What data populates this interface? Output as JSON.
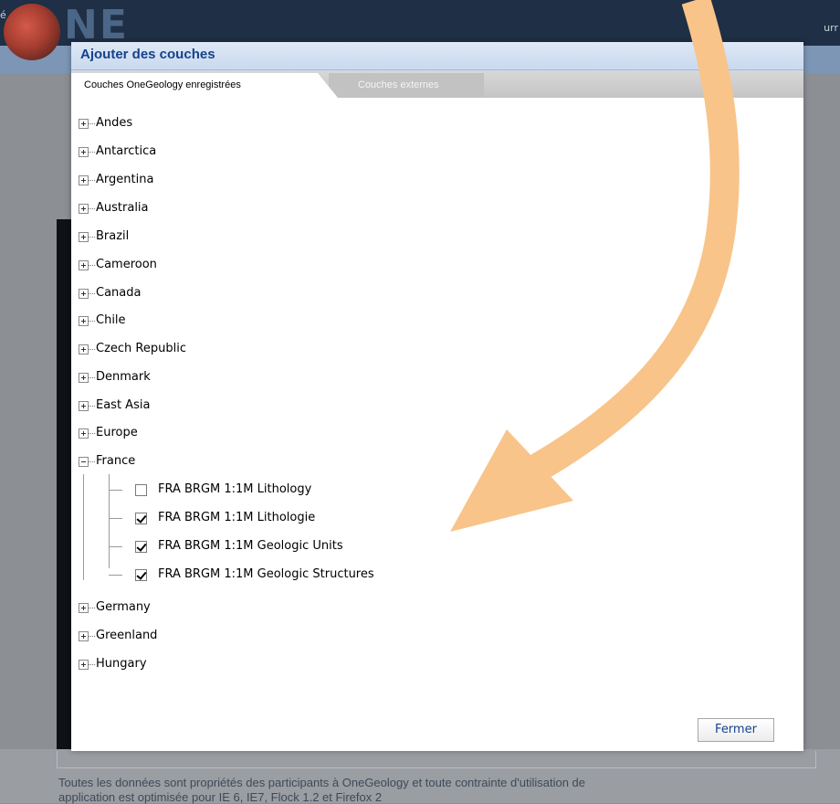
{
  "background": {
    "logo_text": "NE",
    "edge_left_text": "é",
    "edge_right_text": "urr",
    "footer_text_line1": "Toutes les données sont propriétés des participants à OneGeology et toute contrainte d'utilisation de",
    "footer_text_line2": "application est optimisée pour IE 6, IE7, Flock 1.2 et Firefox 2"
  },
  "dialog": {
    "title": "Ajouter des couches",
    "tabs": [
      {
        "label": "Couches OneGeology enregistrées",
        "active": true
      },
      {
        "label": "Couches externes",
        "active": false
      }
    ],
    "tree_top": [
      {
        "label": "Andes"
      },
      {
        "label": "Antarctica"
      },
      {
        "label": "Argentina"
      },
      {
        "label": "Australia"
      },
      {
        "label": "Brazil"
      },
      {
        "label": "Cameroon"
      },
      {
        "label": "Canada"
      },
      {
        "label": "Chile"
      },
      {
        "label": "Czech Republic"
      },
      {
        "label": "Denmark"
      },
      {
        "label": "East Asia"
      },
      {
        "label": "Europe"
      }
    ],
    "france": {
      "label": "France",
      "layers": [
        {
          "label": "FRA BRGM 1:1M Lithology",
          "checked": false
        },
        {
          "label": "FRA BRGM 1:1M Lithologie",
          "checked": true
        },
        {
          "label": "FRA BRGM 1:1M Geologic Units",
          "checked": true
        },
        {
          "label": "FRA BRGM 1:1M Geologic Structures",
          "checked": true
        }
      ]
    },
    "tree_bottom": [
      {
        "label": "Germany"
      },
      {
        "label": "Greenland"
      },
      {
        "label": "Hungary"
      }
    ],
    "close_label": "Fermer"
  },
  "colors": {
    "title_text": "#15428b",
    "arrow": "#f8c48a",
    "header_bg": "#1f2f45"
  }
}
